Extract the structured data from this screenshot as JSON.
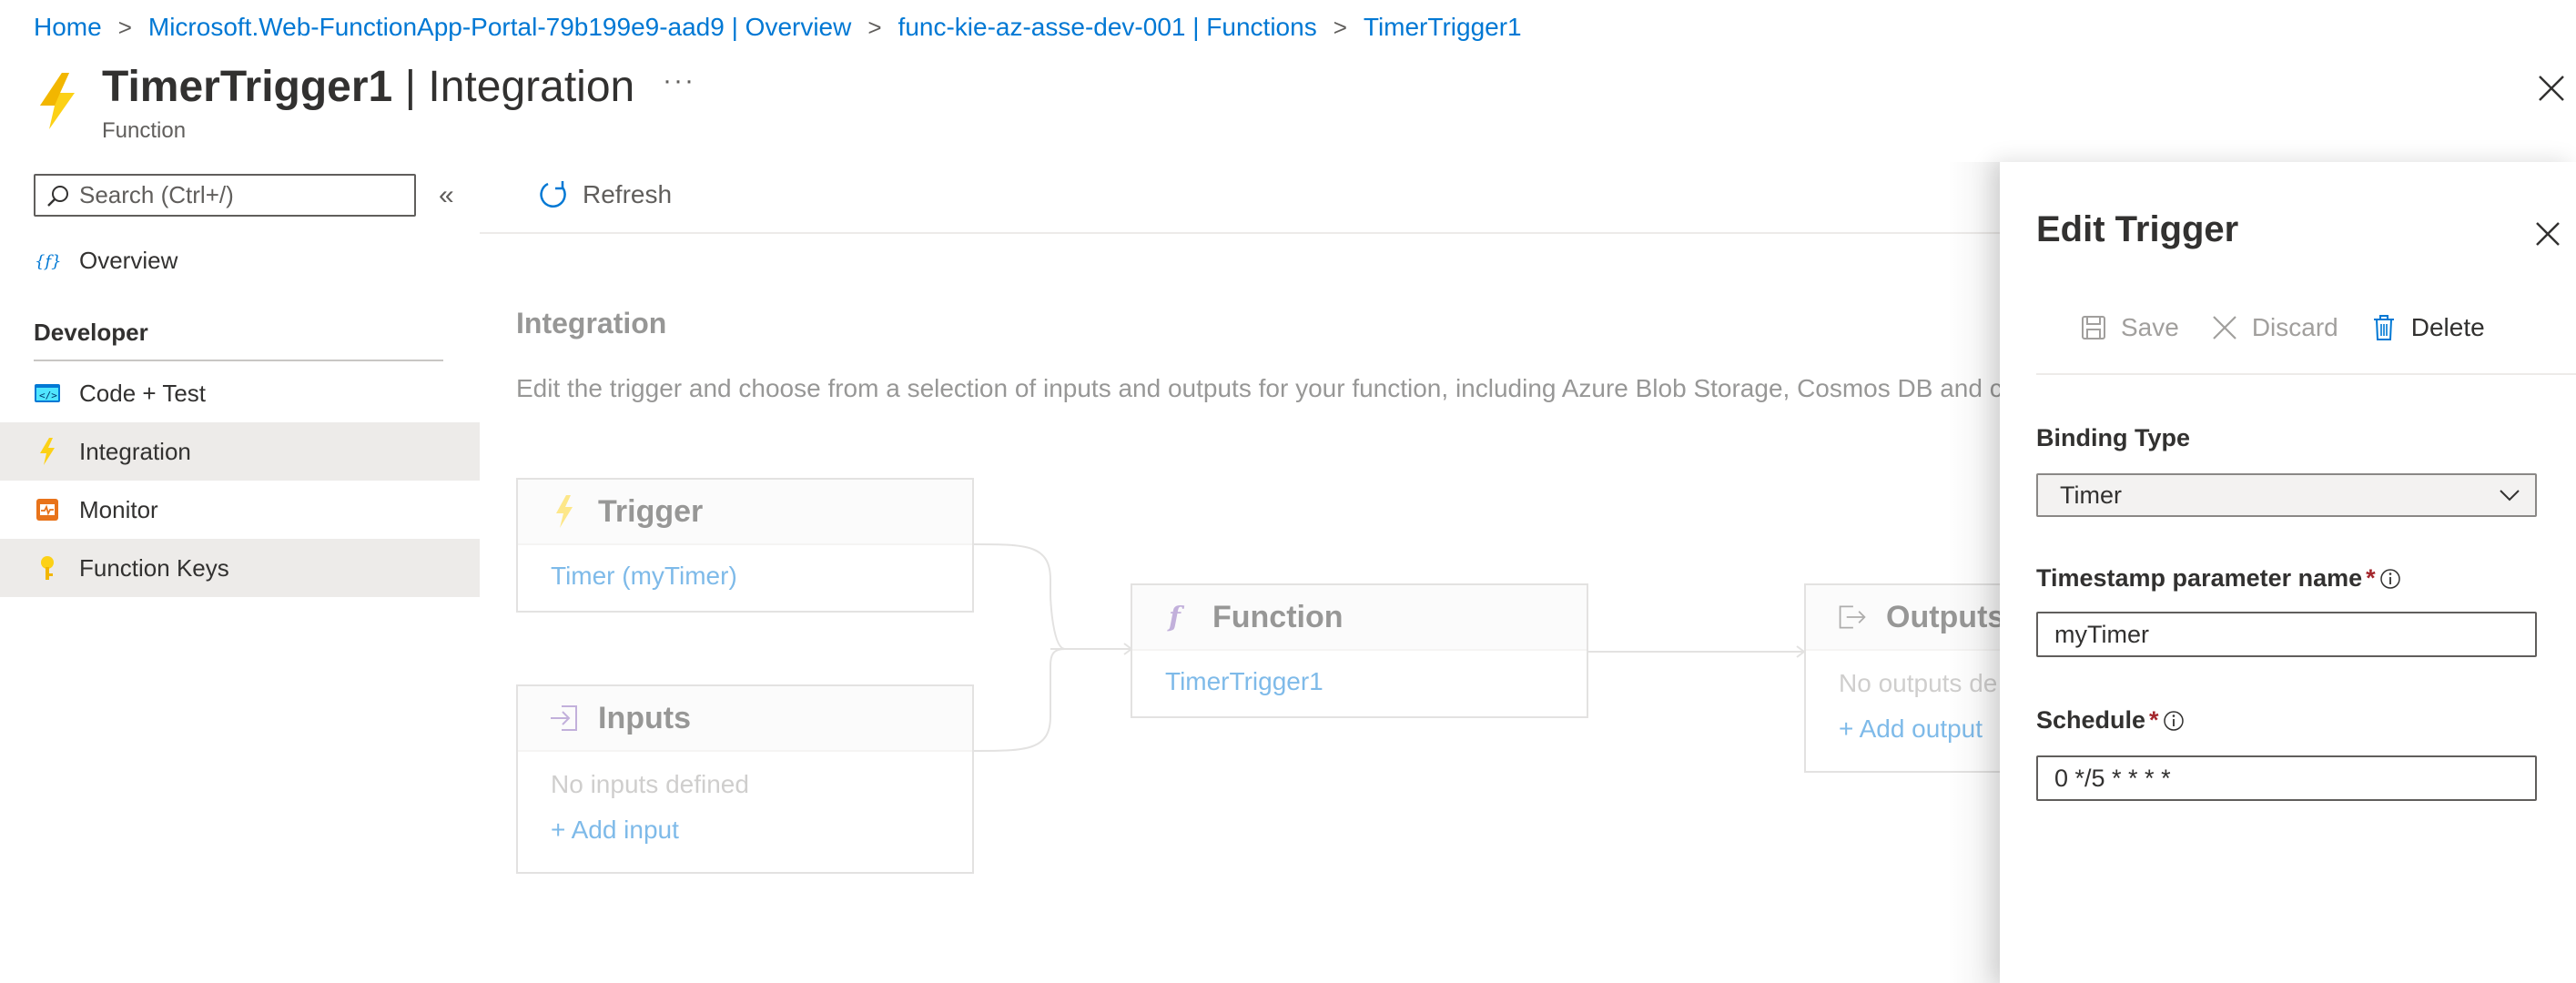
{
  "breadcrumb": {
    "items": [
      "Home",
      "Microsoft.Web-FunctionApp-Portal-79b199e9-aad9 | Overview",
      "func-kie-az-asse-dev-001 | Functions",
      "TimerTrigger1"
    ]
  },
  "header": {
    "title_main": "TimerTrigger1",
    "title_divider": " | ",
    "title_section": "Integration",
    "subtitle": "Function",
    "more": "···"
  },
  "sidebar": {
    "search_placeholder": "Search (Ctrl+/)",
    "collapse": "«",
    "overview": "Overview",
    "section": "Developer",
    "items": [
      {
        "label": "Code + Test",
        "icon": "code-icon"
      },
      {
        "label": "Integration",
        "icon": "lightning-icon"
      },
      {
        "label": "Monitor",
        "icon": "monitor-icon"
      },
      {
        "label": "Function Keys",
        "icon": "key-icon"
      }
    ]
  },
  "toolbar": {
    "refresh": "Refresh"
  },
  "main": {
    "title": "Integration",
    "description": "Edit the trigger and choose from a selection of inputs and outputs for your function, including Azure Blob Storage, Cosmos DB and c",
    "trigger": {
      "title": "Trigger",
      "link": "Timer (myTimer)"
    },
    "inputs": {
      "title": "Inputs",
      "empty": "No inputs defined",
      "add": "+ Add input"
    },
    "function": {
      "title": "Function",
      "link": "TimerTrigger1"
    },
    "outputs": {
      "title": "Outputs",
      "empty": "No outputs de",
      "add": "+ Add output"
    }
  },
  "panel": {
    "title": "Edit Trigger",
    "save": "Save",
    "discard": "Discard",
    "delete": "Delete",
    "binding_type_label": "Binding Type",
    "binding_type_value": "Timer",
    "timestamp_label": "Timestamp parameter name",
    "timestamp_value": "myTimer",
    "schedule_label": "Schedule",
    "schedule_value": "0 */5 * * * *",
    "required_mark": "*"
  },
  "colors": {
    "accent": "#0078d4",
    "lightning": "#fcd116",
    "required": "#a4262c"
  }
}
